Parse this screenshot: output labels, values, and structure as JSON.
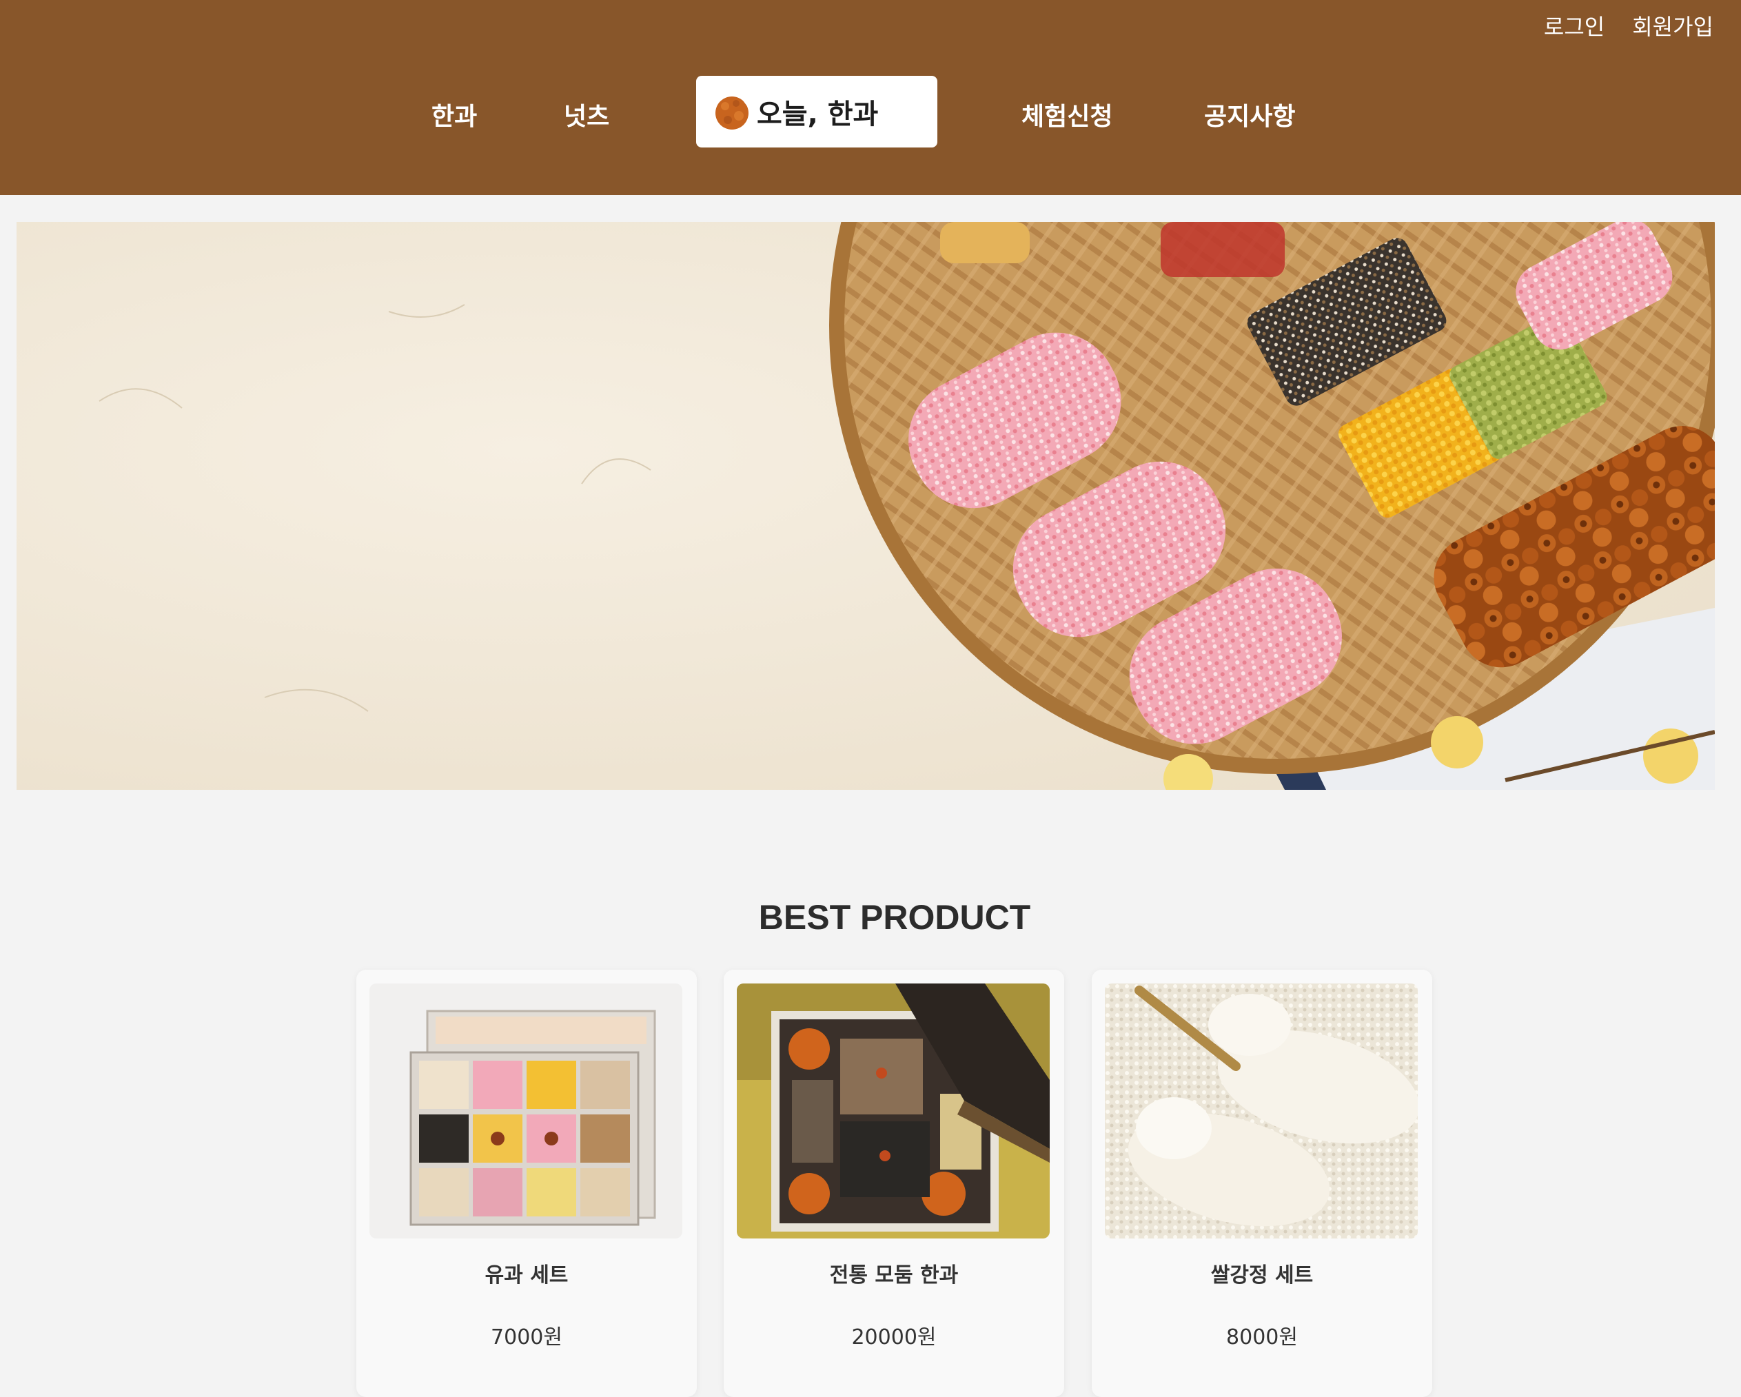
{
  "header": {
    "background": "#88562a",
    "auth": {
      "login": "로그인",
      "signup": "회원가입"
    },
    "nav": {
      "hangwa": "한과",
      "nuts": "넛츠",
      "experience": "체험신청",
      "notice": "공지사항"
    },
    "logo_text": "오늘, 한과"
  },
  "hero": {
    "image": "hangwa-banner-on-bamboo-tray"
  },
  "best": {
    "title": "BEST PRODUCT",
    "products": [
      {
        "name": "유과 세트",
        "price": "7000원",
        "image": "yugwa-set-box"
      },
      {
        "name": "전통 모둠 한과",
        "price": "20000원",
        "image": "assorted-hangwa-box"
      },
      {
        "name": "쌀강정 세트",
        "price": "8000원",
        "image": "rice-gangjeong"
      }
    ]
  }
}
